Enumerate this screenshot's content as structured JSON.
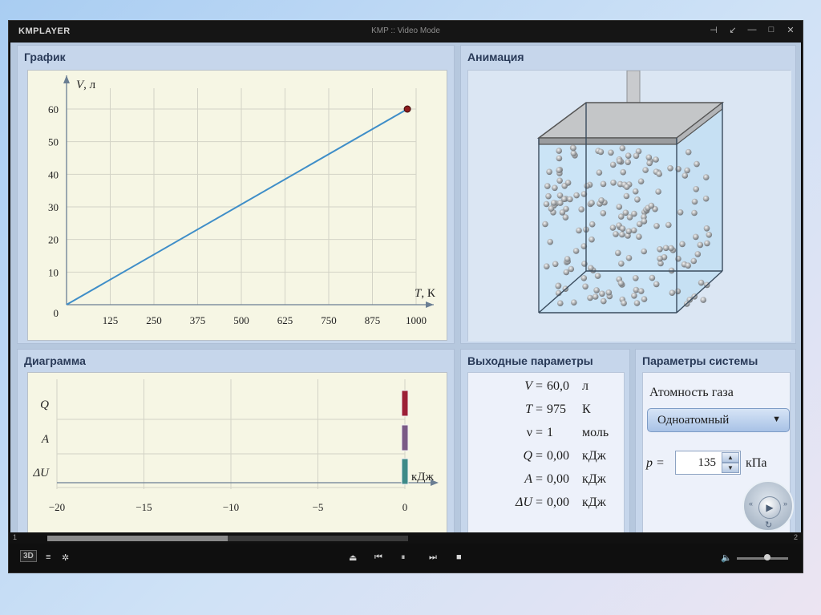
{
  "window": {
    "logo": "KMPLAYER",
    "title": "KMP :: Video Mode",
    "controls": [
      "pin-icon",
      "shrink-icon",
      "minimize-icon",
      "maximize-icon",
      "close-icon"
    ]
  },
  "graph_panel": {
    "title": "График",
    "chart_data": {
      "type": "line",
      "title": "График",
      "xlabel": "T, К",
      "ylabel": "V, л",
      "x_ticks": [
        "125",
        "250",
        "375",
        "500",
        "625",
        "750",
        "875",
        "1000"
      ],
      "y_ticks": [
        "10",
        "20",
        "30",
        "40",
        "50",
        "60"
      ],
      "origin_label": "0",
      "xlim": [
        0,
        1000
      ],
      "ylim": [
        0,
        60
      ],
      "grid": true,
      "series": [
        {
          "x": [
            0,
            975
          ],
          "y": [
            0,
            60
          ],
          "color": "#3f8ec8",
          "end_marker": true
        }
      ]
    }
  },
  "animation_panel": {
    "title": "Анимация",
    "gas_fill": 0.78
  },
  "diagram_panel": {
    "title": "Диаграмма",
    "chart_data": {
      "type": "bar",
      "orientation": "horizontal",
      "title": "Диаграмма",
      "xlabel": "кДж",
      "categories": [
        "Q",
        "A",
        "ΔU"
      ],
      "x_ticks": [
        "−20",
        "−15",
        "−10",
        "−5",
        "0"
      ],
      "xlim": [
        -20,
        0
      ],
      "values": [
        0.0,
        0.0,
        0.0
      ],
      "colors": [
        "#9c1f36",
        "#7a5a86",
        "#3d8a88"
      ],
      "grid": true
    }
  },
  "output_panel": {
    "title": "Выходные параметры",
    "rows": [
      {
        "symbol": "V",
        "value": "60,0",
        "unit": "л"
      },
      {
        "symbol": "T",
        "value": "975",
        "unit": "К"
      },
      {
        "symbol": "ν",
        "value": "1",
        "unit": "моль"
      },
      {
        "symbol": "Q",
        "value": "0,00",
        "unit": "кДж"
      },
      {
        "symbol": "A",
        "value": "0,00",
        "unit": "кДж"
      },
      {
        "symbol": "ΔU",
        "value": "0,00",
        "unit": "кДж"
      }
    ]
  },
  "system_panel": {
    "title": "Параметры системы",
    "atomicity_label": "Атомность газа",
    "atomicity_value": "Одноатомный",
    "pressure_symbol": "p =",
    "pressure_value": "135",
    "pressure_unit": "кПа"
  },
  "player": {
    "seek_start": "1",
    "seek_end": "2",
    "seek_progress": 0.5,
    "volume": 0.6,
    "mode_badge": "3D"
  }
}
